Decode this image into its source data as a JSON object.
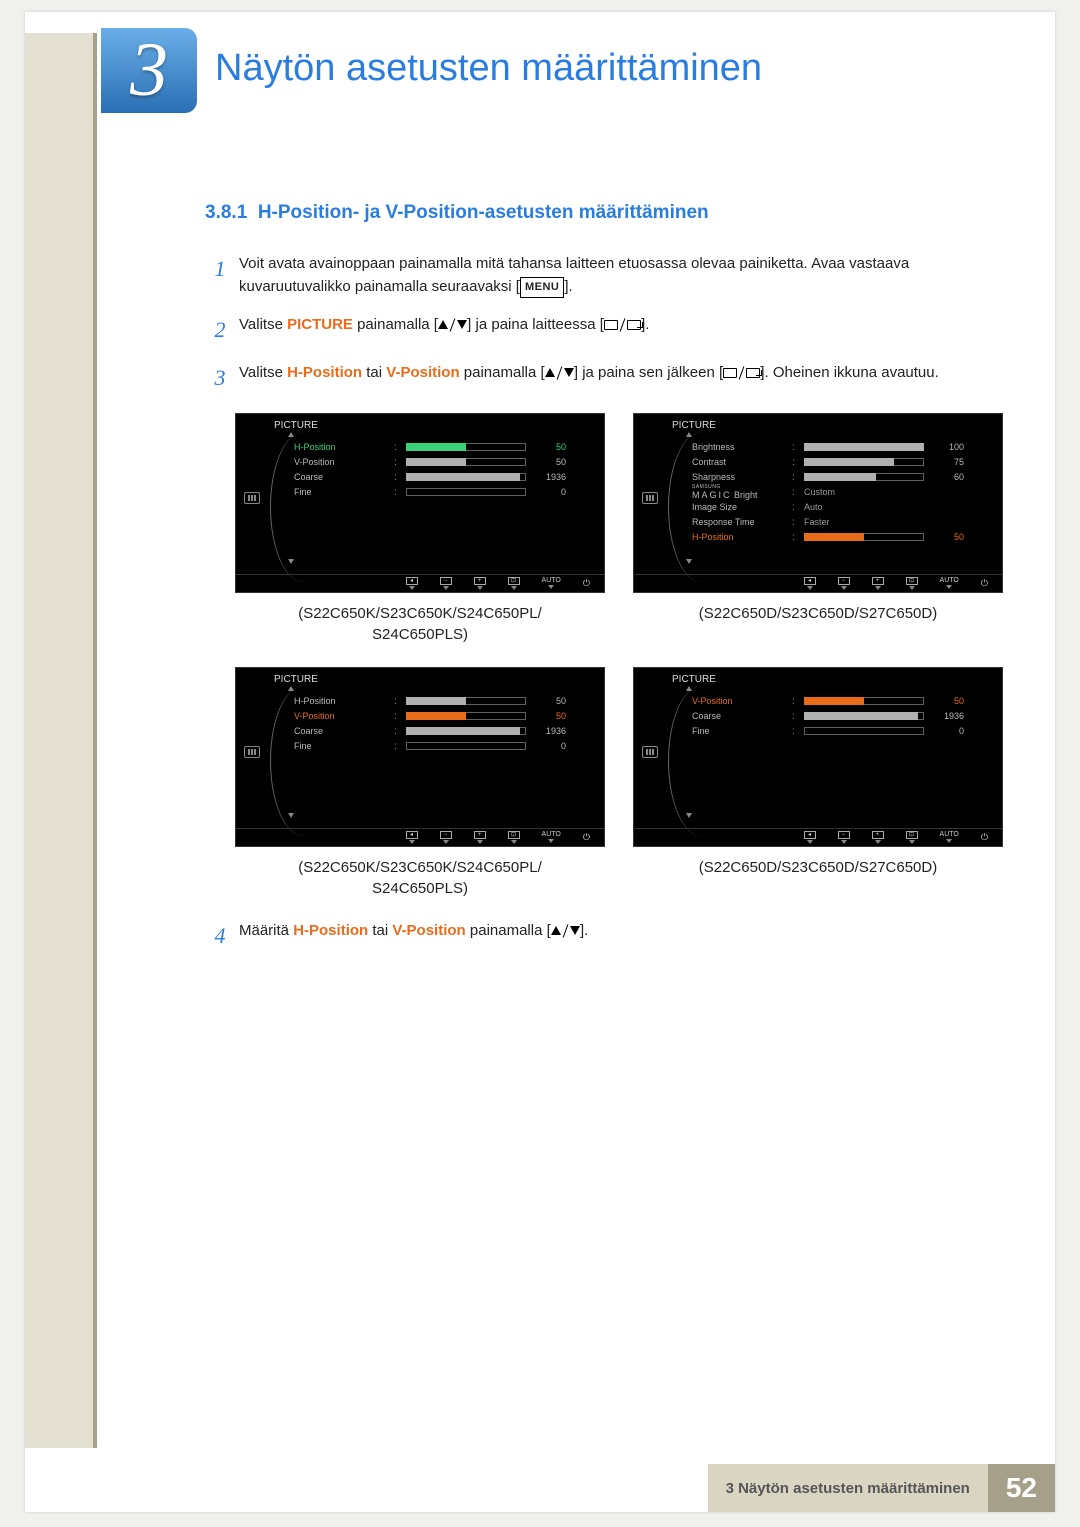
{
  "chapter": {
    "number": "3",
    "title": "Näytön asetusten määrittäminen"
  },
  "subheading": {
    "num": "3.8.1",
    "text": "H-Position- ja V-Position-asetusten määrittäminen"
  },
  "steps": {
    "n1": "1",
    "s1a": "Voit avata avainoppaan painamalla mitä tahansa laitteen etuosassa olevaa painiketta. Avaa vastaava kuvaruutuvalikko painamalla seuraavaksi [",
    "s1b": "].",
    "menu": "MENU",
    "n2": "2",
    "s2a": "Valitse ",
    "s2_pic": "PICTURE",
    "s2b": " painamalla [",
    "s2c": "] ja paina laitteessa [",
    "s2d": "].",
    "n3": "3",
    "s3a": "Valitse ",
    "s3_h": "H-Position",
    "s3_tai": " tai ",
    "s3_v": "V-Position",
    "s3b": " painamalla [",
    "s3c": "] ja paina sen jälkeen [",
    "s3d": "]. Oheinen ikkuna avautuu.",
    "n4": "4",
    "s4a": "Määritä ",
    "s4b": " painamalla [",
    "s4c": "]."
  },
  "osd": {
    "title": "PICTURE",
    "captions": {
      "a": "(S22C650K/S23C650K/S24C650PL/\nS24C650PLS)",
      "b": "(S22C650D/S23C650D/S27C650D)"
    },
    "auto": "AUTO",
    "panel1": [
      {
        "label": "H-Position",
        "value": "50",
        "bar": 50,
        "hl": "green",
        "barcolor": "#39d27a"
      },
      {
        "label": "V-Position",
        "value": "50",
        "bar": 50,
        "barcolor": "#b0b0b0"
      },
      {
        "label": "Coarse",
        "value": "1936",
        "bar": 95,
        "barcolor": "#b0b0b0"
      },
      {
        "label": "Fine",
        "value": "0",
        "bar": 0,
        "barcolor": "#b0b0b0"
      }
    ],
    "panel2": [
      {
        "label": "Brightness",
        "value": "100",
        "bar": 100,
        "barcolor": "#b0b0b0"
      },
      {
        "label": "Contrast",
        "value": "75",
        "bar": 75,
        "barcolor": "#b0b0b0"
      },
      {
        "label": "Sharpness",
        "value": "60",
        "bar": 60,
        "barcolor": "#b0b0b0"
      },
      {
        "label": "MAGIC Bright",
        "text": "Custom",
        "samsung": "SAMSUNG"
      },
      {
        "label": "Image Size",
        "text": "Auto"
      },
      {
        "label": "Response Time",
        "text": "Faster"
      },
      {
        "label": "H-Position",
        "value": "50",
        "bar": 50,
        "hl": "org",
        "barcolor": "#e86c1a"
      }
    ],
    "panel3": [
      {
        "label": "H-Position",
        "value": "50",
        "bar": 50,
        "barcolor": "#b0b0b0"
      },
      {
        "label": "V-Position",
        "value": "50",
        "bar": 50,
        "hl": "org",
        "barcolor": "#e86c1a"
      },
      {
        "label": "Coarse",
        "value": "1936",
        "bar": 95,
        "barcolor": "#b0b0b0"
      },
      {
        "label": "Fine",
        "value": "0",
        "bar": 0,
        "barcolor": "#b0b0b0"
      }
    ],
    "panel4": [
      {
        "label": "V-Position",
        "value": "50",
        "bar": 50,
        "hl": "org",
        "barcolor": "#e86c1a"
      },
      {
        "label": "Coarse",
        "value": "1936",
        "bar": 95,
        "barcolor": "#b0b0b0"
      },
      {
        "label": "Fine",
        "value": "0",
        "bar": 0,
        "barcolor": "#b0b0b0"
      }
    ]
  },
  "footer": {
    "label": "3 Näytön asetusten määrittäminen",
    "page": "52"
  }
}
